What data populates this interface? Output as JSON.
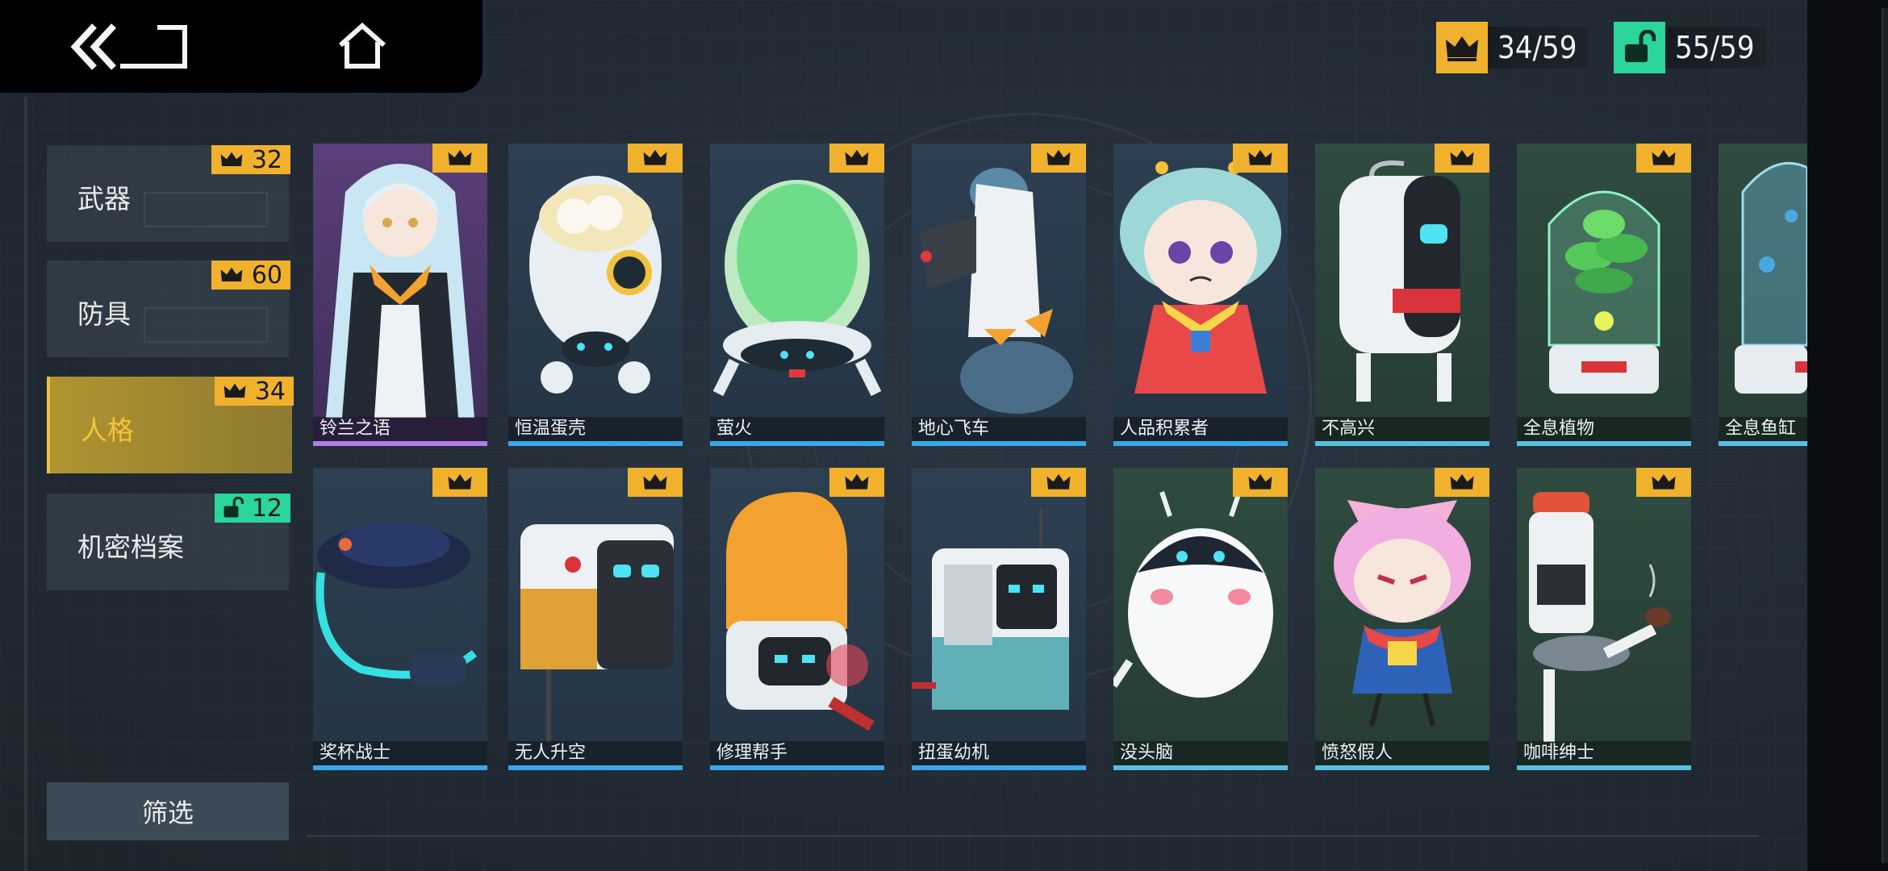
{
  "header": {
    "icons": [
      "double-chevron-back-icon",
      "home-icon"
    ],
    "crown_count": "34/59",
    "unlock_count": "55/59"
  },
  "sidebar": {
    "categories": [
      {
        "label": "武器",
        "badge_icon": "crown-icon",
        "count": "32",
        "active": false
      },
      {
        "label": "防具",
        "badge_icon": "crown-icon",
        "count": "60",
        "active": false
      },
      {
        "label": "人格",
        "badge_icon": "crown-icon",
        "count": "34",
        "active": true
      },
      {
        "label": "机密档案",
        "badge_icon": "unlock-icon",
        "count": "12",
        "active": false
      }
    ],
    "filter_label": "筛选"
  },
  "grid": {
    "row1": [
      {
        "name": "铃兰之语",
        "theme": "purple"
      },
      {
        "name": "恒温蛋壳",
        "theme": "blue"
      },
      {
        "name": "萤火",
        "theme": "blue"
      },
      {
        "name": "地心飞车",
        "theme": "blue"
      },
      {
        "name": "人品积累者",
        "theme": "blue"
      },
      {
        "name": "不高兴",
        "theme": "green"
      },
      {
        "name": "全息植物",
        "theme": "green"
      },
      {
        "name": "全息鱼缸",
        "theme": "green"
      }
    ],
    "row2": [
      {
        "name": "奖杯战士",
        "theme": "blue"
      },
      {
        "name": "无人升空",
        "theme": "blue"
      },
      {
        "name": "修理帮手",
        "theme": "blue"
      },
      {
        "name": "扭蛋幼机",
        "theme": "blue"
      },
      {
        "name": "没头脑",
        "theme": "green"
      },
      {
        "name": "愤怒假人",
        "theme": "green"
      },
      {
        "name": "咖啡绅士",
        "theme": "green"
      }
    ]
  },
  "colors": {
    "gold": "#f0b12c",
    "green": "#2ad49a",
    "blue_stripe": "#3aa8e8"
  }
}
